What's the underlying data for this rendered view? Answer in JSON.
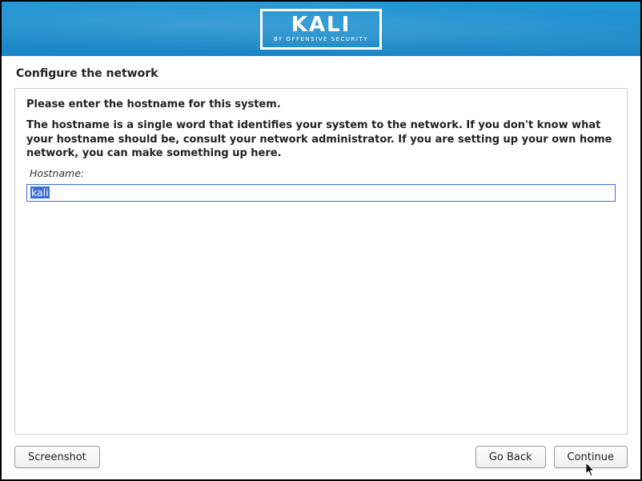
{
  "header": {
    "logo_text": "KALI",
    "logo_sub": "BY OFFENSIVE SECURITY"
  },
  "page": {
    "title": "Configure the network"
  },
  "main": {
    "prompt": "Please enter the hostname for this system.",
    "description": "The hostname is a single word that identifies your system to the network. If you don't know what your hostname should be, consult your network administrator. If you are setting up your own home network, you can make something up here.",
    "field_label": "Hostname:",
    "hostname_value": "kali"
  },
  "footer": {
    "screenshot_label": "Screenshot",
    "go_back_label": "Go Back",
    "continue_label": "Continue"
  }
}
